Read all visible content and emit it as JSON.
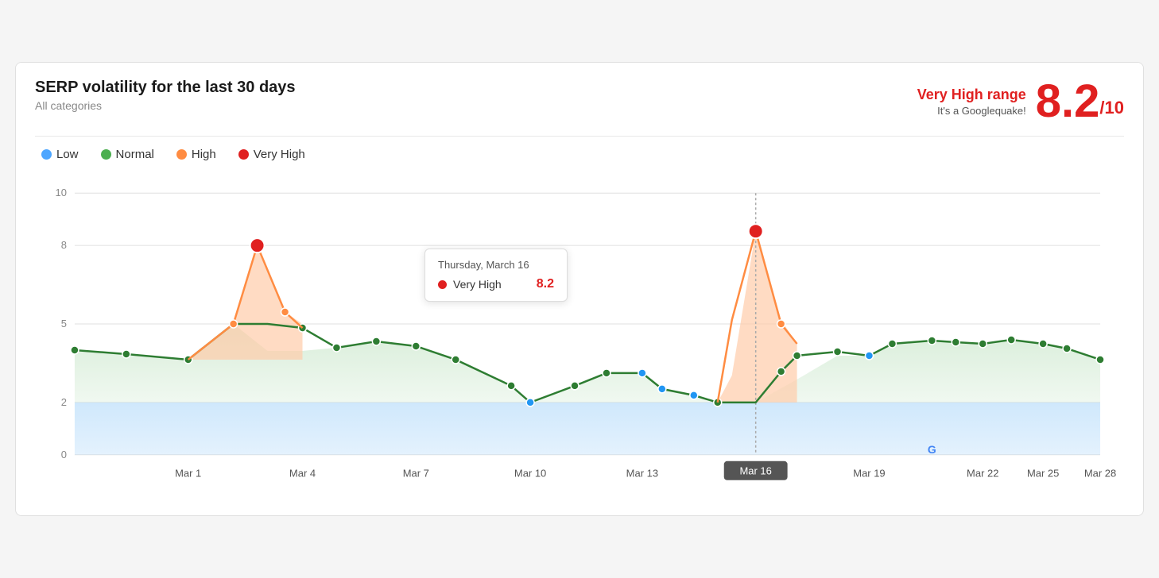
{
  "header": {
    "title": "SERP volatility for the last 30 days",
    "subtitle": "All categories",
    "range_title": "Very High range",
    "range_sub": "It's a Googlequake!",
    "score": "8.2",
    "score_denom": "/10"
  },
  "legend": {
    "items": [
      {
        "label": "Low",
        "color": "#4da6ff"
      },
      {
        "label": "Normal",
        "color": "#4caf50"
      },
      {
        "label": "High",
        "color": "#ff8c42"
      },
      {
        "label": "Very High",
        "color": "#e02020"
      }
    ]
  },
  "tooltip": {
    "date": "Thursday, March 16",
    "label": "Very High",
    "value": "8.2"
  },
  "chart": {
    "x_labels": [
      "Mar 1",
      "Mar 4",
      "Mar 7",
      "Mar 10",
      "Mar 13",
      "Mar 16",
      "Mar 19",
      "Mar 22",
      "Mar 25",
      "Mar 28"
    ],
    "y_labels": [
      "0",
      "2",
      "5",
      "8",
      "10"
    ],
    "highlighted_x": "Mar 16"
  },
  "colors": {
    "very_high": "#e02020",
    "high": "#ff8c42",
    "normal": "#4caf50",
    "low": "#4da6ff",
    "accent": "#e02020"
  }
}
